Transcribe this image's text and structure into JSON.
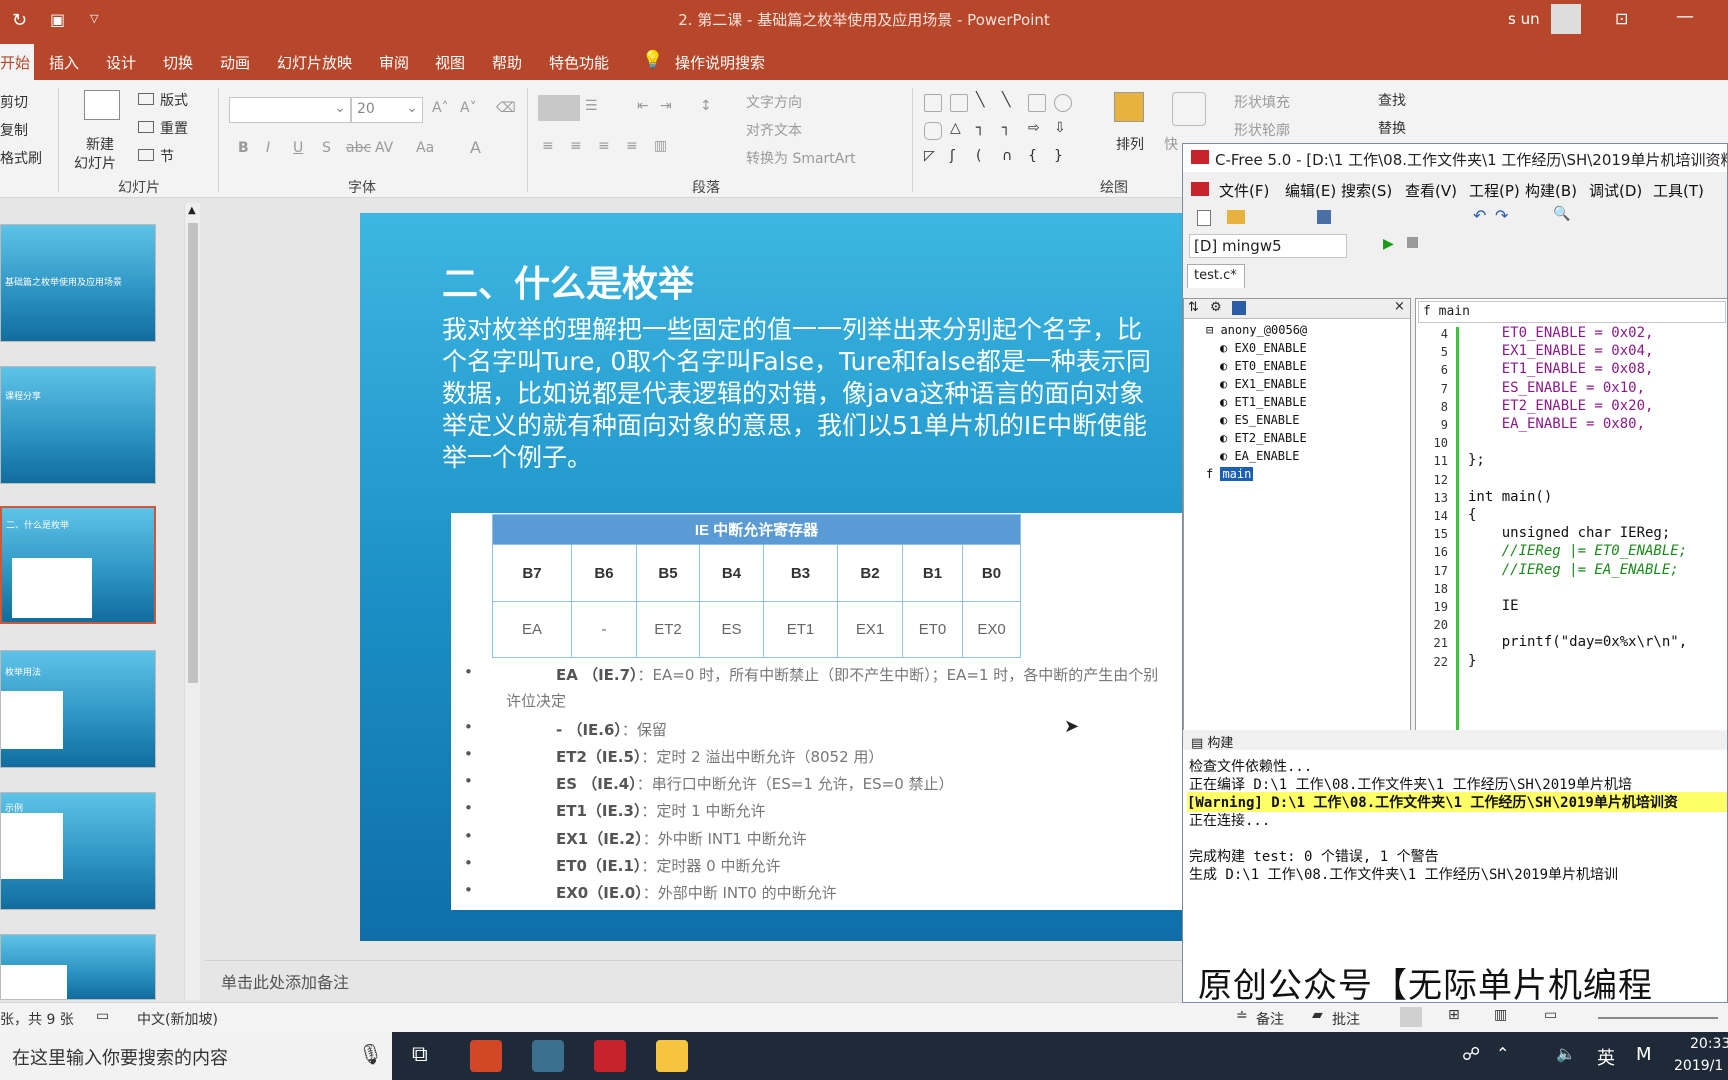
{
  "app": {
    "window_title": "2. 第二课 - 基础篇之枚举使用及应用场景  -  PowerPoint",
    "user": "s un"
  },
  "ribbon_tabs": [
    "开始",
    "插入",
    "设计",
    "切换",
    "动画",
    "幻灯片放映",
    "审阅",
    "视图",
    "帮助",
    "特色功能"
  ],
  "tell_me": "操作说明搜索",
  "ribbon": {
    "clipboard": {
      "cut": "剪切",
      "copy": "复制",
      "format_painter": "格式刷"
    },
    "slides": {
      "new_slide_1": "新建",
      "new_slide_2": "幻灯片",
      "layout": "版式",
      "reset": "重置",
      "section": "节",
      "group": "幻灯片"
    },
    "font": {
      "size": "20",
      "group": "字体"
    },
    "paragraph": {
      "text_direction": "文字方向",
      "align_text": "对齐文本",
      "smartart": "转换为 SmartArt",
      "group": "段落"
    },
    "drawing": {
      "arrange": "排列",
      "quick": "快",
      "shape_fill": "形状填充",
      "shape_outline": "形状轮廓",
      "group": "绘图"
    },
    "editing": {
      "find": "查找",
      "replace": "替换"
    }
  },
  "slide": {
    "title": "二、什么是枚举",
    "para_lines": [
      "我对枚举的理解把一些固定的值一一列举出来分别起个名字，比",
      "个名字叫Ture, 0取个名字叫False，Ture和false都是一种表示同",
      "数据，比如说都是代表逻辑的对错，像java这种语言的面向对象",
      "举定义的就有种面向对象的意思，我们以51单片机的IE中断使能",
      "举一个例子。"
    ],
    "table": {
      "header": "IE  中断允许寄存器",
      "bits": [
        "B7",
        "B6",
        "B5",
        "B4",
        "B3",
        "B2",
        "B1",
        "B0"
      ],
      "fields": [
        "EA",
        "-",
        "ET2",
        "ES",
        "ET1",
        "EX1",
        "ET0",
        "EX0"
      ]
    },
    "bullets": [
      {
        "k": "EA （IE.7）",
        "v": "：EA=0 时，所有中断禁止（即不产生中断）；EA=1 时，各中断的产生由个别"
      },
      {
        "k": "",
        "v": "许位决定"
      },
      {
        "k": "- （IE.6）",
        "v": "：保留"
      },
      {
        "k": "ET2（IE.5）",
        "v": "：定时 2 溢出中断允许（8052 用）"
      },
      {
        "k": "ES （IE.4）",
        "v": "：串行口中断允许（ES=1 允许，ES=0 禁止）"
      },
      {
        "k": "ET1（IE.3）",
        "v": "：定时 1 中断允许"
      },
      {
        "k": "EX1（IE.2）",
        "v": "：外中断 INT1 中断允许"
      },
      {
        "k": "ET0（IE.1）",
        "v": "：定时器 0 中断允许"
      },
      {
        "k": "EX0（IE.0）",
        "v": "：外部中断 INT0 的中断允许"
      }
    ]
  },
  "thumbnails": [
    {
      "title": "基础篇之枚举使用及应用场景"
    },
    {
      "title": "课程分享"
    },
    {
      "title": "二、什么是枚举"
    },
    {
      "title": "枚举用法"
    },
    {
      "title": "示例"
    },
    {
      "title": ""
    }
  ],
  "notes_placeholder": "单击此处添加备注",
  "status": {
    "slide_count": "张，共 9 张",
    "language": "中文(新加坡)",
    "notes": "备注",
    "comments": "批注"
  },
  "taskbar": {
    "search_placeholder": "在这里输入你要搜索的内容",
    "time": "20:33",
    "date": "2019/1",
    "ime": "英"
  },
  "cfree": {
    "title": "C-Free 5.0 - [D:\\1 工作\\08.工作文件夹\\1 工作经历\\SH\\2019单片机培训资料",
    "menu": [
      "文件(F)",
      "编辑(E)",
      "搜索(S)",
      "查看(V)",
      "工程(P)",
      "构建(B)",
      "调试(D)",
      "工具(T)"
    ],
    "compiler": "[D] mingw5",
    "tab": "test.c*",
    "func_combo": "main",
    "tree_root": "anony_@0056@",
    "tree_items": [
      "EX0_ENABLE",
      "ET0_ENABLE",
      "EX1_ENABLE",
      "ET1_ENABLE",
      "ES_ENABLE",
      "ET2_ENABLE",
      "EA_ENABLE"
    ],
    "tree_main": "main",
    "code": [
      {
        "n": "4",
        "t": "    ET0_ENABLE = 0x02,",
        "c": "mag"
      },
      {
        "n": "5",
        "t": "    EX1_ENABLE = 0x04,",
        "c": "mag"
      },
      {
        "n": "6",
        "t": "    ET1_ENABLE = 0x08,",
        "c": "mag"
      },
      {
        "n": "7",
        "t": "    ES_ENABLE = 0x10,",
        "c": "mag"
      },
      {
        "n": "8",
        "t": "    ET2_ENABLE = 0x20,",
        "c": "mag"
      },
      {
        "n": "9",
        "t": "    EA_ENABLE = 0x80,",
        "c": "mag"
      },
      {
        "n": "10",
        "t": "",
        "c": ""
      },
      {
        "n": "11",
        "t": "};",
        "c": ""
      },
      {
        "n": "12",
        "t": "",
        "c": ""
      },
      {
        "n": "13",
        "t": "int main()",
        "c": ""
      },
      {
        "n": "14",
        "t": "{",
        "c": ""
      },
      {
        "n": "15",
        "t": "    unsigned char IEReg;",
        "c": ""
      },
      {
        "n": "16",
        "t": "    //IEReg |= ET0_ENABLE;",
        "c": "cm"
      },
      {
        "n": "17",
        "t": "    //IEReg |= EA_ENABLE;",
        "c": "cm"
      },
      {
        "n": "18",
        "t": "",
        "c": ""
      },
      {
        "n": "19",
        "t": "    IE",
        "c": ""
      },
      {
        "n": "20",
        "t": "",
        "c": ""
      },
      {
        "n": "21",
        "t": "    printf(\"day=0x%x\\r\\n\",",
        "c": ""
      },
      {
        "n": "22",
        "t": "}",
        "c": ""
      }
    ],
    "build_label": "构建",
    "build_output": [
      "检查文件依赖性...",
      "正在编译 D:\\1 工作\\08.工作文件夹\\1 工作经历\\SH\\2019单片机培",
      "[Warning] D:\\1 工作\\08.工作文件夹\\1 工作经历\\SH\\2019单片机培训资",
      "正在连接...",
      "",
      "完成构建 test: 0 个错误, 1 个警告",
      "生成 D:\\1 工作\\08.工作文件夹\\1 工作经历\\SH\\2019单片机培训"
    ]
  },
  "watermark": "原创公众号【无际单片机编程"
}
